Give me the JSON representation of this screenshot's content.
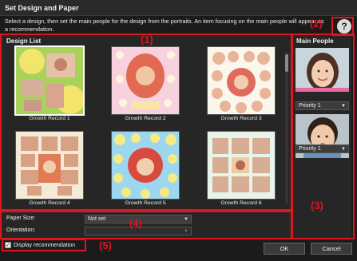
{
  "window": {
    "title": "Set Design and Paper"
  },
  "instructions": "Select a design, then set the main people for the design from the portraits. An item focusing on the main people will appear as a recommendation.",
  "help": {
    "icon": "help-icon",
    "label": "?"
  },
  "design_list": {
    "title": "Design List",
    "items": [
      {
        "label": "Growth Record 1",
        "selected": true
      },
      {
        "label": "Growth Record 2",
        "selected": false
      },
      {
        "label": "Growth Record 3",
        "selected": false
      },
      {
        "label": "Growth Record 4",
        "selected": false
      },
      {
        "label": "Growth Record 5",
        "selected": false
      },
      {
        "label": "Growth Record 6",
        "selected": false
      }
    ]
  },
  "main_people": {
    "title": "Main People",
    "people": [
      {
        "priority": "Priority 1"
      },
      {
        "priority": "Priority 1"
      }
    ]
  },
  "paper": {
    "size_label": "Paper Size:",
    "size_value": "Not set",
    "orientation_label": "Orientation:",
    "orientation_value": ""
  },
  "footer": {
    "display_recommendation_label": "Display recommendation",
    "display_recommendation_checked": true,
    "ok_label": "OK",
    "cancel_label": "Cancel"
  },
  "callouts": [
    "(1)",
    "(2)",
    "(3)",
    "(4)",
    "(5)"
  ],
  "colors": {
    "callout": "#e0141d",
    "background": "#1b1b1b",
    "panel": "#262626"
  }
}
